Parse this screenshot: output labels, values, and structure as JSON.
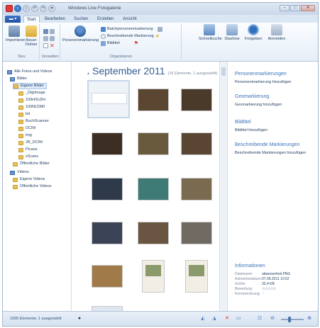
{
  "window": {
    "title": "Windows Live Fotogalerie"
  },
  "titlebar": {
    "minimize": "–",
    "maximize": "□",
    "close": "✕"
  },
  "tabs": [
    "Start",
    "Bearbeiten",
    "Suchen",
    "Erstellen",
    "Ansicht"
  ],
  "ribbon": {
    "neu": {
      "label": "Neu",
      "importieren": "Importieren",
      "neuer_ordner": "Neuer Ordner"
    },
    "verwalten": {
      "label": "Verwalten"
    },
    "organisieren": {
      "label": "Organisieren",
      "personenmarkierung": "Personenmarkierung",
      "batch": "Batchpersonenmarkierung",
      "beschreibende": "Beschreibende Markierung",
      "bildtitel": "Bildtitel"
    },
    "schnellsuche": "Schnellsuche",
    "diashow": "Diashow",
    "freigeben": "Freigeben",
    "anmelden": "Anmelden"
  },
  "nav": {
    "items": [
      {
        "label": "Alle Fotos und Videos"
      },
      {
        "label": "Bilder"
      },
      {
        "label": "Eigene Bilder"
      },
      {
        "label": "_DigiImage"
      },
      {
        "label": "100HSUZH"
      },
      {
        "label": "100NCD80"
      },
      {
        "label": "bd"
      },
      {
        "label": "BuchScanner"
      },
      {
        "label": "DCIM"
      },
      {
        "label": "img"
      },
      {
        "label": "JR_DCIM"
      },
      {
        "label": "Picasa"
      },
      {
        "label": "xScans"
      },
      {
        "label": "Öffentliche Bilder"
      },
      {
        "label": "Videos"
      },
      {
        "label": "Eigene Videos"
      },
      {
        "label": "Öffentliche Videos"
      }
    ]
  },
  "gallery": {
    "month": "September 2011",
    "count": "(16 Elemente, 1 ausgewählt)"
  },
  "right": {
    "pm_head": "Personenmarkierungen",
    "pm_add": "Personenmarkierung hinzufügen",
    "geo_head": "Geomarkierung",
    "geo_add": "Geomarkierung hinzufügen",
    "bt_head": "Bildtitel",
    "bt_add": "Bildtitel hinzufügen",
    "bm_head": "Beschreibende Markierungen",
    "bm_add": "Beschreibende Markierungen hinzufügen",
    "info_head": "Informationen",
    "info": [
      {
        "k": "Dateiname:",
        "v": "abwesenheit.PNG"
      },
      {
        "k": "Aufnahmedatum:",
        "v": "07.09.2011  10:52"
      },
      {
        "k": "Größe:",
        "v": "32,4 KB"
      },
      {
        "k": "Bewertung:",
        "v": "☆☆☆☆☆"
      },
      {
        "k": "Kennzeichnung:",
        "v": "⚐"
      }
    ]
  },
  "status": {
    "text": "1005 Elemente, 1 ausgewählt"
  },
  "colors": {
    "accent": "#3a73b8",
    "file_tab": "#1f50a3",
    "folder": "#e9c25a"
  }
}
